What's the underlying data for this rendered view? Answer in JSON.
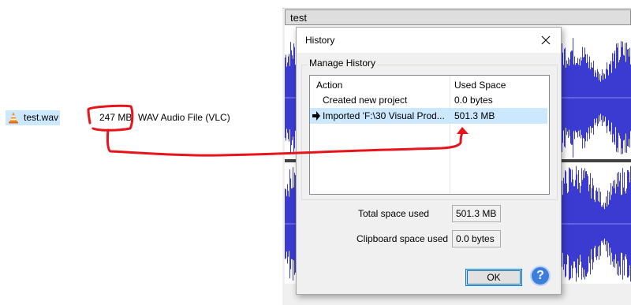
{
  "explorer": {
    "file_name": "test.wav",
    "file_size": "247 MB",
    "file_type": "WAV Audio File (VLC)"
  },
  "audacity": {
    "track_name": "test"
  },
  "dialog": {
    "title": "History",
    "close_glyph": "✕",
    "group_label": "Manage History",
    "columns": [
      "Action",
      "Used Space"
    ],
    "rows": [
      {
        "action": "Created new project",
        "space": "0.0 bytes",
        "current": false
      },
      {
        "action": "Imported 'F:\\30 Visual Prod...",
        "space": "501.3 MB",
        "current": true
      }
    ],
    "total_label": "Total space used",
    "total_value": "501.3 MB",
    "clipboard_label": "Clipboard space used",
    "clipboard_value": "0.0 bytes",
    "ok_label": "OK",
    "help_glyph": "?"
  },
  "colors": {
    "annotation": "#e8141b",
    "waveform": "#3b3bd2",
    "selection": "#cce8ff"
  }
}
